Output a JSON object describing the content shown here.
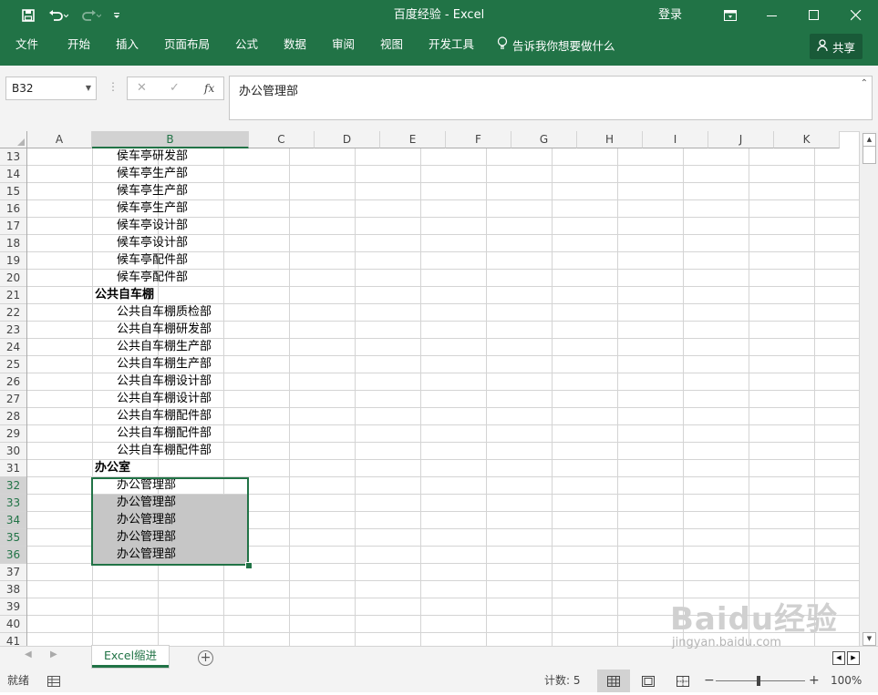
{
  "window": {
    "title": "百度经验  -  Excel",
    "login_label": "登录"
  },
  "ribbon": {
    "tabs": [
      "文件",
      "开始",
      "插入",
      "页面布局",
      "公式",
      "数据",
      "审阅",
      "视图",
      "开发工具"
    ],
    "tell_me": "告诉我你想要做什么",
    "share_label": "共享"
  },
  "formula_bar": {
    "name_box": "B32",
    "content": "办公管理部",
    "fx_label": "fx"
  },
  "columns": [
    "A",
    "B",
    "C",
    "D",
    "E",
    "F",
    "G",
    "H",
    "I",
    "J",
    "K"
  ],
  "rows": [
    {
      "num": "13",
      "text": "侯车亭研发部",
      "indent": true,
      "bold": false,
      "selected": false,
      "highlight": false
    },
    {
      "num": "14",
      "text": "候车亭生产部",
      "indent": true,
      "bold": false,
      "selected": false,
      "highlight": false
    },
    {
      "num": "15",
      "text": "候车亭生产部",
      "indent": true,
      "bold": false,
      "selected": false,
      "highlight": false
    },
    {
      "num": "16",
      "text": "候车亭生产部",
      "indent": true,
      "bold": false,
      "selected": false,
      "highlight": false
    },
    {
      "num": "17",
      "text": "候车亭设计部",
      "indent": true,
      "bold": false,
      "selected": false,
      "highlight": false
    },
    {
      "num": "18",
      "text": "候车亭设计部",
      "indent": true,
      "bold": false,
      "selected": false,
      "highlight": false
    },
    {
      "num": "19",
      "text": "候车亭配件部",
      "indent": true,
      "bold": false,
      "selected": false,
      "highlight": false
    },
    {
      "num": "20",
      "text": "候车亭配件部",
      "indent": true,
      "bold": false,
      "selected": false,
      "highlight": false
    },
    {
      "num": "21",
      "text": "公共自车棚",
      "indent": false,
      "bold": true,
      "selected": false,
      "highlight": false
    },
    {
      "num": "22",
      "text": "公共自车棚质检部",
      "indent": true,
      "bold": false,
      "selected": false,
      "highlight": false
    },
    {
      "num": "23",
      "text": "公共自车棚研发部",
      "indent": true,
      "bold": false,
      "selected": false,
      "highlight": false
    },
    {
      "num": "24",
      "text": "公共自车棚生产部",
      "indent": true,
      "bold": false,
      "selected": false,
      "highlight": false
    },
    {
      "num": "25",
      "text": "公共自车棚生产部",
      "indent": true,
      "bold": false,
      "selected": false,
      "highlight": false
    },
    {
      "num": "26",
      "text": "公共自车棚设计部",
      "indent": true,
      "bold": false,
      "selected": false,
      "highlight": false
    },
    {
      "num": "27",
      "text": "公共自车棚设计部",
      "indent": true,
      "bold": false,
      "selected": false,
      "highlight": false
    },
    {
      "num": "28",
      "text": "公共自车棚配件部",
      "indent": true,
      "bold": false,
      "selected": false,
      "highlight": false
    },
    {
      "num": "29",
      "text": "公共自车棚配件部",
      "indent": true,
      "bold": false,
      "selected": false,
      "highlight": false
    },
    {
      "num": "30",
      "text": "公共自车棚配件部",
      "indent": true,
      "bold": false,
      "selected": false,
      "highlight": false
    },
    {
      "num": "31",
      "text": "办公室",
      "indent": false,
      "bold": true,
      "selected": false,
      "highlight": false
    },
    {
      "num": "32",
      "text": "办公管理部",
      "indent": true,
      "bold": false,
      "selected": true,
      "highlight": false
    },
    {
      "num": "33",
      "text": "办公管理部",
      "indent": true,
      "bold": false,
      "selected": true,
      "highlight": true
    },
    {
      "num": "34",
      "text": "办公管理部",
      "indent": true,
      "bold": false,
      "selected": true,
      "highlight": true
    },
    {
      "num": "35",
      "text": "办公管理部",
      "indent": true,
      "bold": false,
      "selected": true,
      "highlight": true
    },
    {
      "num": "36",
      "text": "办公管理部",
      "indent": true,
      "bold": false,
      "selected": true,
      "highlight": true
    },
    {
      "num": "37",
      "text": "",
      "indent": false,
      "bold": false,
      "selected": false,
      "highlight": false
    },
    {
      "num": "38",
      "text": "",
      "indent": false,
      "bold": false,
      "selected": false,
      "highlight": false
    },
    {
      "num": "39",
      "text": "",
      "indent": false,
      "bold": false,
      "selected": false,
      "highlight": false
    },
    {
      "num": "40",
      "text": "",
      "indent": false,
      "bold": false,
      "selected": false,
      "highlight": false
    },
    {
      "num": "41",
      "text": "",
      "indent": false,
      "bold": false,
      "selected": false,
      "highlight": false
    }
  ],
  "sheet_tabs": [
    "Excel缩进"
  ],
  "status": {
    "ready": "就绪",
    "count": "计数: 5",
    "zoom": "100%"
  },
  "watermark": {
    "brand": "Baidu经验",
    "url": "jingyan.baidu.com"
  },
  "colors": {
    "excel_green": "#217346",
    "selection_fill": "#c6c6c6"
  }
}
